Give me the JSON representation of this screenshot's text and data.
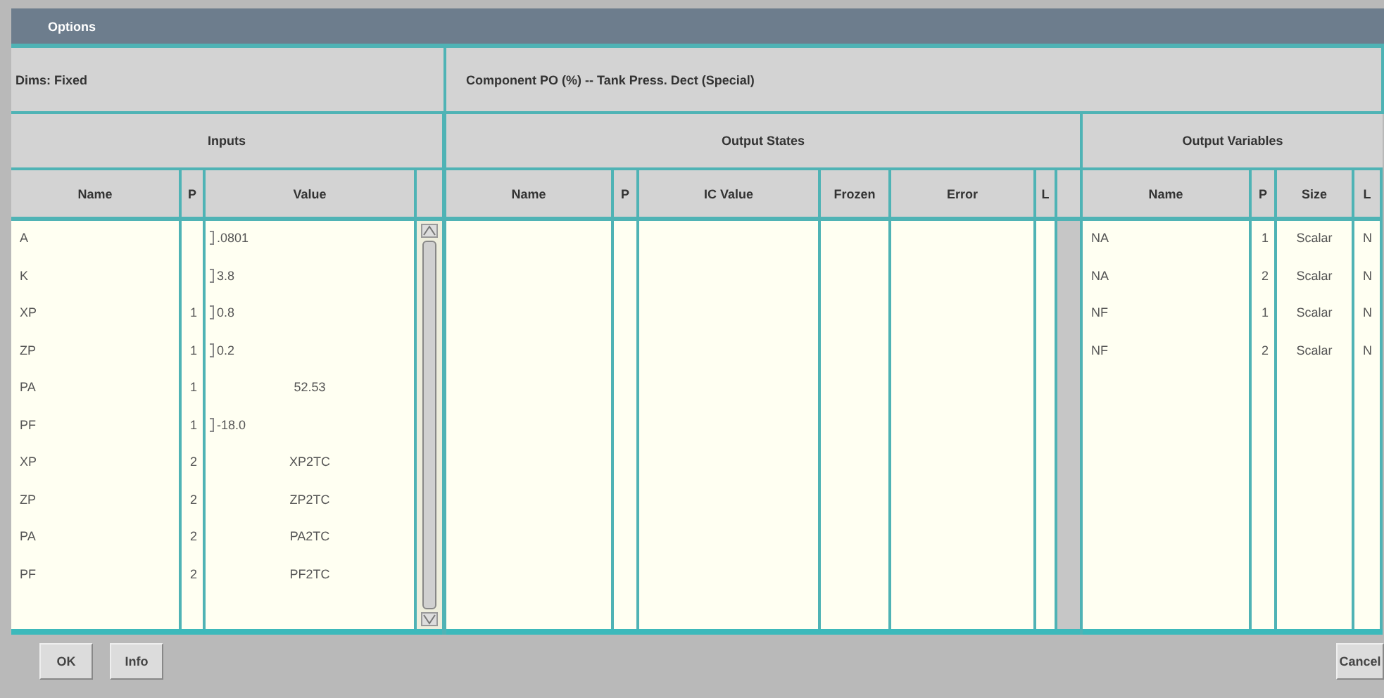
{
  "window": {
    "title": "Options"
  },
  "dims": "Dims: Fixed",
  "component": "Component PO (%) -- Tank Press. Dect (Special)",
  "inputs": {
    "title": "Inputs",
    "columns": [
      "Name",
      "P",
      "Value"
    ],
    "rows": [
      {
        "name": "A",
        "value": ".0801",
        "kind": "field"
      },
      {
        "name": "K",
        "value": "3.8",
        "kind": "field"
      },
      {
        "name": "XP",
        "p": "1",
        "value": "0.8",
        "kind": "field"
      },
      {
        "name": "ZP",
        "p": "1",
        "value": "0.2",
        "kind": "field"
      },
      {
        "name": "PA",
        "p": "1",
        "value": "52.53",
        "kind": "text"
      },
      {
        "name": "PF",
        "p": "1",
        "value": "-18.0",
        "kind": "field"
      },
      {
        "name": "XP",
        "p": "2",
        "value": "XP2TC",
        "kind": "text"
      },
      {
        "name": "ZP",
        "p": "2",
        "value": "ZP2TC",
        "kind": "text"
      },
      {
        "name": "PA",
        "p": "2",
        "value": "PA2TC",
        "kind": "text"
      },
      {
        "name": "PF",
        "p": "2",
        "value": "PF2TC",
        "kind": "text"
      }
    ]
  },
  "output_states": {
    "title": "Output States",
    "columns": [
      "Name",
      "P",
      "IC Value",
      "Frozen",
      "Error",
      "L"
    ]
  },
  "output_variables": {
    "title": "Output Variables",
    "columns": [
      "Name",
      "P",
      "Size",
      "L"
    ],
    "rows": [
      {
        "name": "NA",
        "p": "1",
        "size": "Scalar",
        "l": "N"
      },
      {
        "name": "NA",
        "p": "2",
        "size": "Scalar",
        "l": "N"
      },
      {
        "name": "NF",
        "p": "1",
        "size": "Scalar",
        "l": "N"
      },
      {
        "name": "NF",
        "p": "2",
        "size": "Scalar",
        "l": "N"
      }
    ]
  },
  "buttons": [
    {
      "label": "OK"
    },
    {
      "label": "Info"
    },
    {
      "label": "Cancel"
    }
  ]
}
